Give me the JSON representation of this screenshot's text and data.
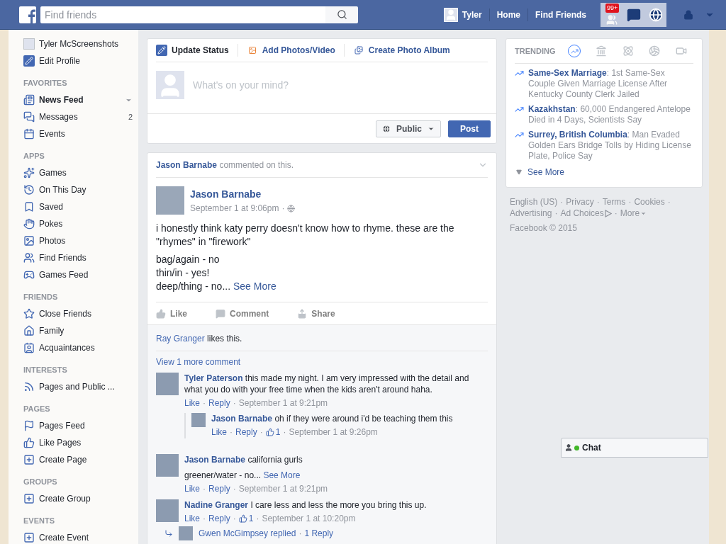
{
  "separator": "·",
  "topbar": {
    "search_placeholder": "Find friends",
    "user": "Tyler",
    "nav": [
      "Home",
      "Find Friends"
    ],
    "badge": "99+"
  },
  "sidebar": {
    "profile": [
      {
        "label": "Tyler McScreenshots",
        "selected": false
      },
      {
        "label": "Edit Profile",
        "selected": false
      }
    ],
    "sections": [
      {
        "title": "FAVORITES",
        "items": [
          {
            "label": "News Feed",
            "selected": true
          },
          {
            "label": "Messages",
            "count": "2",
            "selected": false
          },
          {
            "label": "Events",
            "selected": false
          }
        ]
      },
      {
        "title": "APPS",
        "items": [
          {
            "label": "Games",
            "selected": false
          },
          {
            "label": "On This Day",
            "selected": false
          },
          {
            "label": "Saved",
            "selected": false
          },
          {
            "label": "Pokes",
            "selected": false
          },
          {
            "label": "Photos",
            "selected": false
          },
          {
            "label": "Find Friends",
            "selected": false
          },
          {
            "label": "Games Feed",
            "selected": false
          }
        ]
      },
      {
        "title": "FRIENDS",
        "items": [
          {
            "label": "Close Friends",
            "selected": false
          },
          {
            "label": "Family",
            "selected": false
          },
          {
            "label": "Acquaintances",
            "selected": false
          }
        ]
      },
      {
        "title": "INTERESTS",
        "items": [
          {
            "label": "Pages and Public ...",
            "selected": false
          }
        ]
      },
      {
        "title": "PAGES",
        "items": [
          {
            "label": "Pages Feed",
            "selected": false
          },
          {
            "label": "Like Pages",
            "selected": false
          },
          {
            "label": "Create Page",
            "selected": false
          }
        ]
      },
      {
        "title": "GROUPS",
        "items": [
          {
            "label": "Create Group",
            "selected": false
          }
        ]
      },
      {
        "title": "EVENTS",
        "items": [
          {
            "label": "Create Event",
            "selected": false
          }
        ]
      }
    ]
  },
  "composer": {
    "tabs": [
      {
        "label": "Update Status",
        "selected": true
      },
      {
        "label": "Add Photos/Video",
        "selected": false
      },
      {
        "label": "Create Photo Album",
        "selected": false
      }
    ],
    "placeholder": "What's on your mind?",
    "privacy": "Public",
    "post": "Post"
  },
  "post": {
    "story_actor": "Jason Barnabe",
    "story_text": "commented on this.",
    "author": "Jason Barnabe",
    "time": "September 1 at 9:06pm",
    "paragraph": "i honestly think katy perry doesn't know how to rhyme. these are the \"rhymes\" in \"firework\"",
    "lines": [
      "bag/again - no",
      "thin/in - yes!",
      "deep/thing - no..."
    ],
    "see_more": "See More",
    "actions": [
      {
        "kind": "like",
        "label": "Like"
      },
      {
        "kind": "comment",
        "label": "Comment"
      },
      {
        "kind": "share",
        "label": "Share"
      }
    ],
    "likes": {
      "name": "Ray Granger",
      "text": "likes this."
    },
    "view_more": "View 1 more comment",
    "comments": [
      {
        "author": "Tyler Paterson",
        "text": "this made my night. I am very impressed with the detail and what you do with your free time when the kids aren't around haha.",
        "like": "Like",
        "reply": "Reply",
        "time": "September 1 at 9:21pm",
        "replies": [
          {
            "author": "Jason Barnabe",
            "text": "oh if they were around i'd be teaching them this",
            "like": "Like",
            "reply": "Reply",
            "likes": "1",
            "time": "September 1 at 9:26pm"
          }
        ]
      },
      {
        "author": "Jason Barnabe",
        "text": "california gurls",
        "extra": "greener/water - no...",
        "see_more": "See More",
        "like": "Like",
        "reply": "Reply",
        "time": "September 1 at 9:21pm"
      },
      {
        "author": "Nadine Granger",
        "text": "I care less and less the more you bring this up.",
        "like": "Like",
        "reply": "Reply",
        "likes": "1",
        "time": "September 1 at 10:20pm",
        "reply_summary": {
          "text": "Gwen McGimpsey replied",
          "count": "1 Reply"
        }
      }
    ]
  },
  "trending": {
    "title": "TRENDING",
    "delimiter": ":",
    "tabs": [
      {
        "kind": "trending",
        "selected": true
      },
      {
        "kind": "politics",
        "selected": false
      },
      {
        "kind": "science",
        "selected": false
      },
      {
        "kind": "sports",
        "selected": false
      },
      {
        "kind": "entertainment",
        "selected": false
      }
    ],
    "items": [
      {
        "topic": "Same-Sex Marriage",
        "headline": "1st Same-Sex Couple Given Marriage License After Kentucky County Clerk Jailed"
      },
      {
        "topic": "Kazakhstan",
        "headline": "60,000 Endangered Antelope Died in 4 Days, Scientists Say"
      },
      {
        "topic": "Surrey, British Columbia",
        "headline": "Man Evaded Golden Ears Bridge Tolls by Hiding License Plate, Police Say"
      }
    ],
    "see_more": "See More"
  },
  "footer": {
    "links": [
      "English (US)",
      "Privacy",
      "Terms",
      "Cookies",
      "Advertising",
      "Ad Choices",
      "More"
    ],
    "copyright": "Facebook © 2015"
  },
  "chat": {
    "label": "Chat"
  }
}
